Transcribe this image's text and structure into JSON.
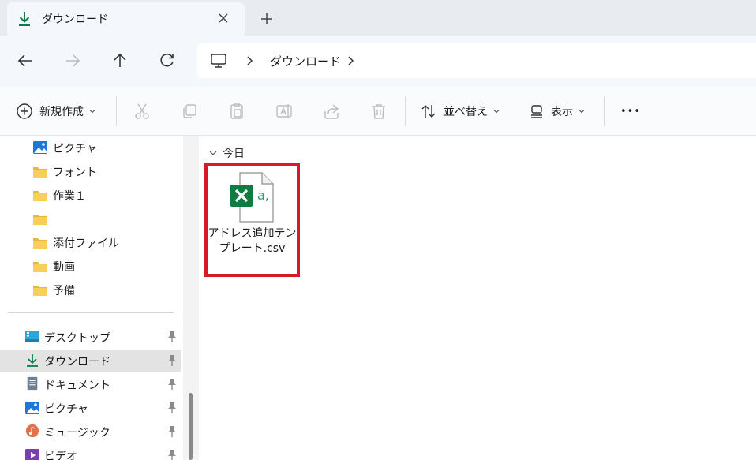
{
  "tab": {
    "title": "ダウンロード"
  },
  "address": {
    "crumbs": [
      "ダウンロード"
    ]
  },
  "toolbar": {
    "new_label": "新規作成",
    "sort_label": "並べ替え",
    "view_label": "表示",
    "more_label": "•••"
  },
  "sidebar": {
    "folders": [
      {
        "label": "ピクチャ",
        "icon": "pictures-icon"
      },
      {
        "label": "フォント",
        "icon": "folder-icon"
      },
      {
        "label": "作業１",
        "icon": "folder-icon"
      },
      {
        "label": "",
        "icon": "folder-icon"
      },
      {
        "label": "添付ファイル",
        "icon": "folder-icon"
      },
      {
        "label": "動画",
        "icon": "folder-icon"
      },
      {
        "label": "予備",
        "icon": "folder-icon"
      }
    ],
    "pinned": [
      {
        "label": "デスクトップ",
        "icon": "desktop-icon"
      },
      {
        "label": "ダウンロード",
        "icon": "download-icon",
        "selected": true
      },
      {
        "label": "ドキュメント",
        "icon": "documents-icon"
      },
      {
        "label": "ピクチャ",
        "icon": "pictures-icon"
      },
      {
        "label": "ミュージック",
        "icon": "music-icon"
      },
      {
        "label": "ビデオ",
        "icon": "videos-icon"
      }
    ]
  },
  "content": {
    "group_label": "今日",
    "files": [
      {
        "name": "アドレス追加テンプレート.csv",
        "icon": "excel-csv-icon",
        "highlighted": true
      }
    ]
  },
  "colors": {
    "accent": "#0f7b4a",
    "highlight": "#d81b22",
    "excel_green": "#107c41"
  }
}
